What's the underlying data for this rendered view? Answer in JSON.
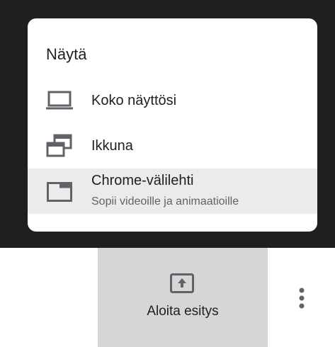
{
  "menu": {
    "title": "Näytä",
    "items": [
      {
        "label": "Koko näyttösi",
        "icon": "laptop-icon"
      },
      {
        "label": "Ikkuna",
        "icon": "window-icon"
      },
      {
        "label": "Chrome-välilehti",
        "sublabel": "Sopii videoille ja animaatioille",
        "icon": "browser-tab-icon",
        "selected": true
      }
    ]
  },
  "present": {
    "label": "Aloita esitys",
    "icon": "present-to-all-icon"
  },
  "more": {
    "icon": "more-vert-icon"
  },
  "colors": {
    "overlay": "#1f1f1f",
    "card": "#ffffff",
    "selected_row": "#ebebeb",
    "present_bg": "#d6d6d6",
    "icon": "#5f6368",
    "text": "#202124",
    "subtext": "#5f6368"
  }
}
